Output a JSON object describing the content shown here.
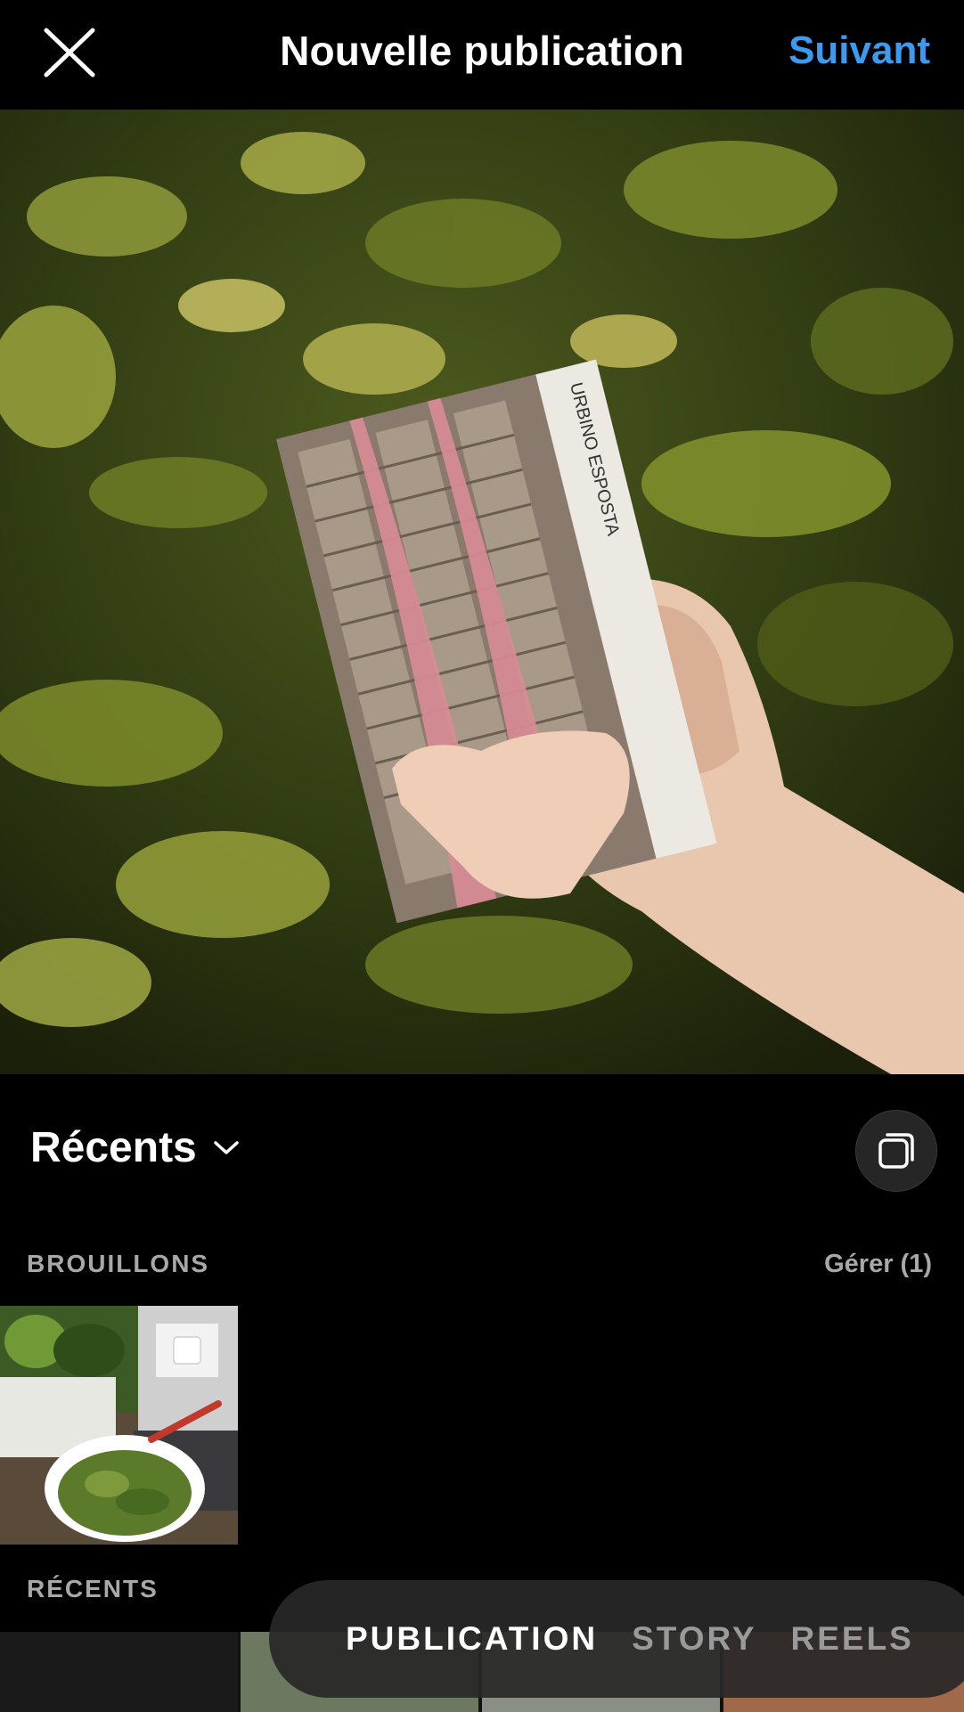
{
  "header": {
    "title": "Nouvelle publication",
    "next_label": "Suivant",
    "close_icon": "close-icon"
  },
  "preview": {
    "book_spine_text": "URBINO ESPOSTA"
  },
  "album": {
    "title": "Récents",
    "dropdown_icon": "chevron-down-icon",
    "multi_select_icon": "multiple-select-icon"
  },
  "drafts": {
    "label": "BROUILLONS",
    "manage_label": "Gérer (1)"
  },
  "recents": {
    "label": "RÉCENTS"
  },
  "modes": {
    "items": [
      "PUBLICATION",
      "STORY",
      "REELS"
    ],
    "active": "PUBLICATION"
  },
  "colors": {
    "accent": "#3a9bf0",
    "background": "#000000",
    "muted": "#a8a8a8"
  }
}
